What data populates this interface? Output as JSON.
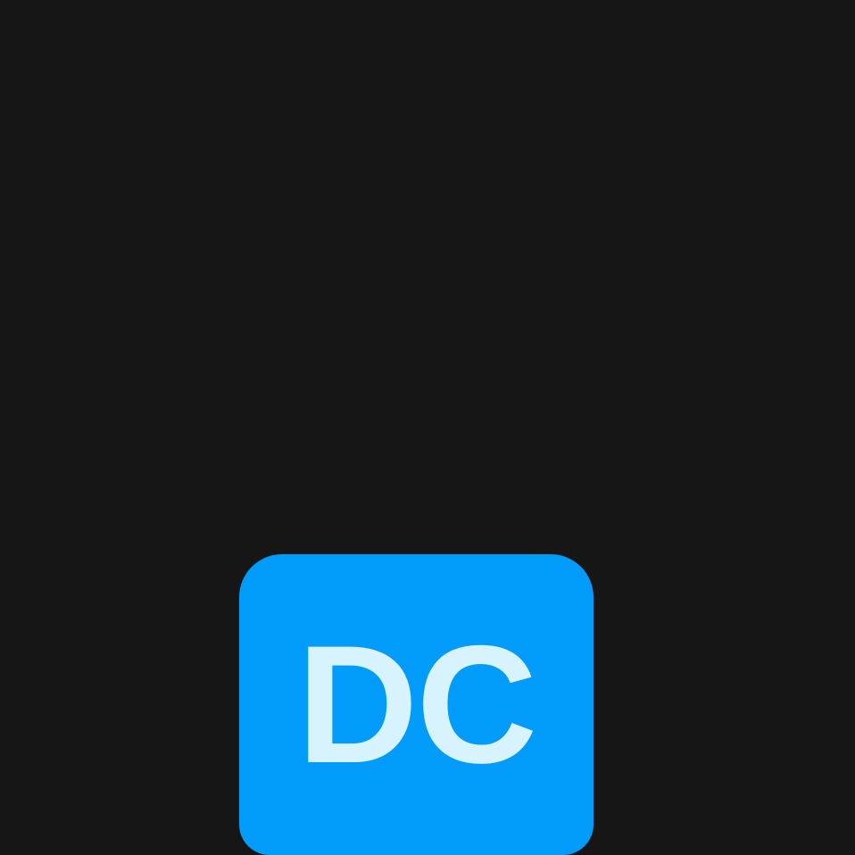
{
  "app_icon": {
    "initials": "DC",
    "background_color": "#019bf9",
    "text_color": "#d6f3fe"
  },
  "screen": {
    "background_color": "#161616"
  }
}
